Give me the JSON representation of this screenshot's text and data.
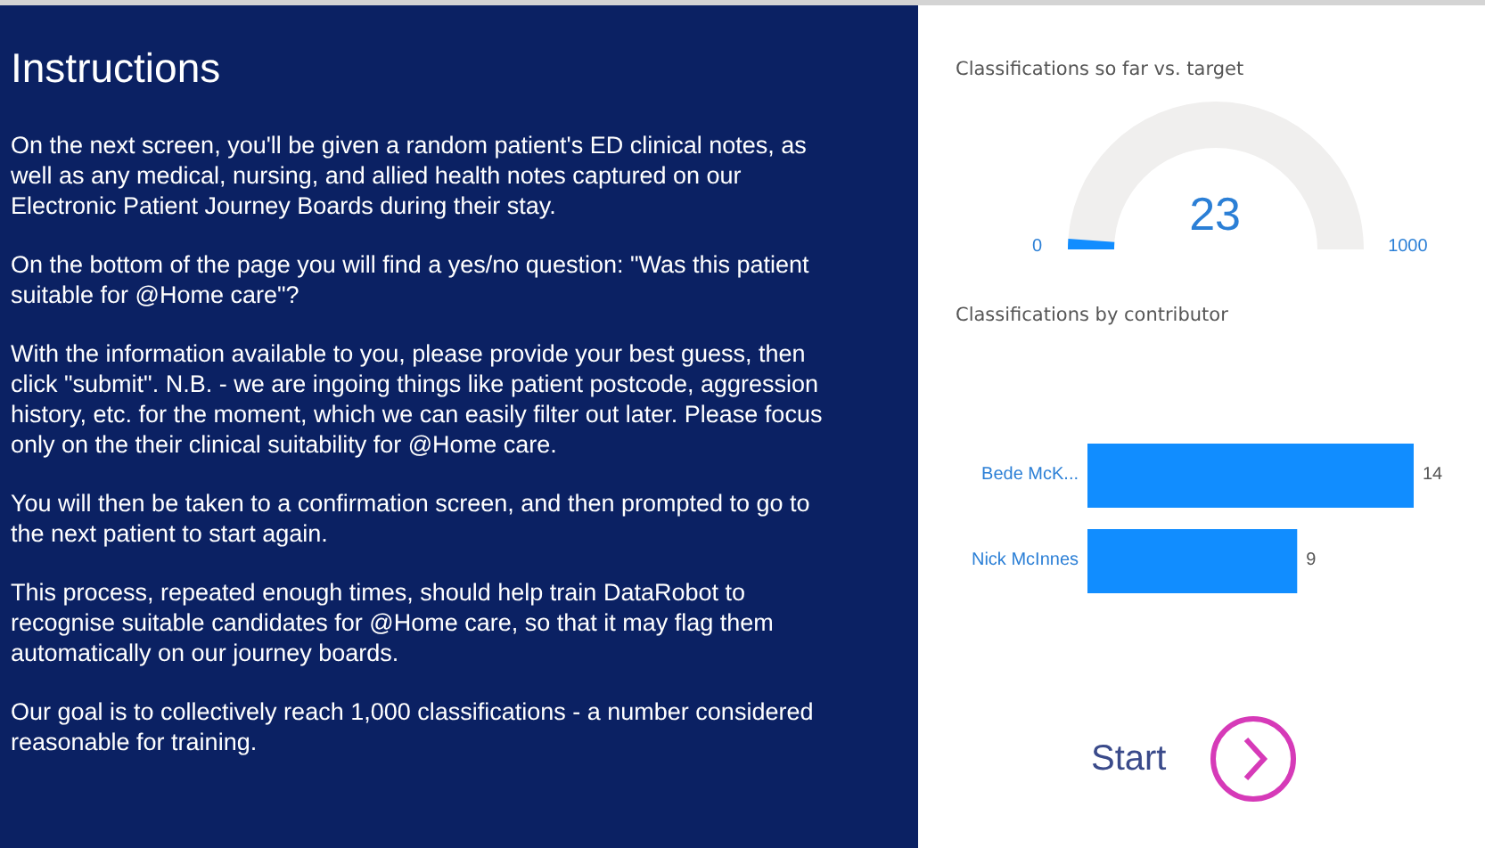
{
  "instructions": {
    "title": "Instructions",
    "paragraphs": [
      "On the next screen, you'll be given a random patient's ED clinical notes, as well as any medical, nursing, and allied health notes captured on our Electronic Patient Journey Boards during their stay.",
      "On the bottom of the page you will find a yes/no question: \"Was this patient suitable for @Home care\"?",
      "With the information available to you, please provide your best guess, then click \"submit\". N.B. - we are ingoing things like patient postcode, aggression history, etc. for the moment, which we can easily filter out later. Please focus only on the their clinical suitability for @Home care.",
      "You will then be taken to a confirmation screen,  and then prompted to go to the next patient to start again.",
      "This process, repeated enough times, should help train DataRobot to recognise suitable candidates for @Home care, so that it may flag them automatically on our journey boards.",
      "Our goal is to collectively reach 1,000 classifications - a number considered reasonable for training."
    ]
  },
  "gauge": {
    "title": "Classifications so far vs. target",
    "value": "23",
    "min": "0",
    "max": "1000",
    "level": 0.023
  },
  "contributors": {
    "title": "Classifications by contributor",
    "chart_data": {
      "type": "bar",
      "orientation": "horizontal",
      "categories": [
        "Bede McK...",
        "Nick McInnes"
      ],
      "values": [
        14,
        9
      ],
      "data_labels": true
    }
  },
  "start_button": {
    "label": "Start"
  }
}
